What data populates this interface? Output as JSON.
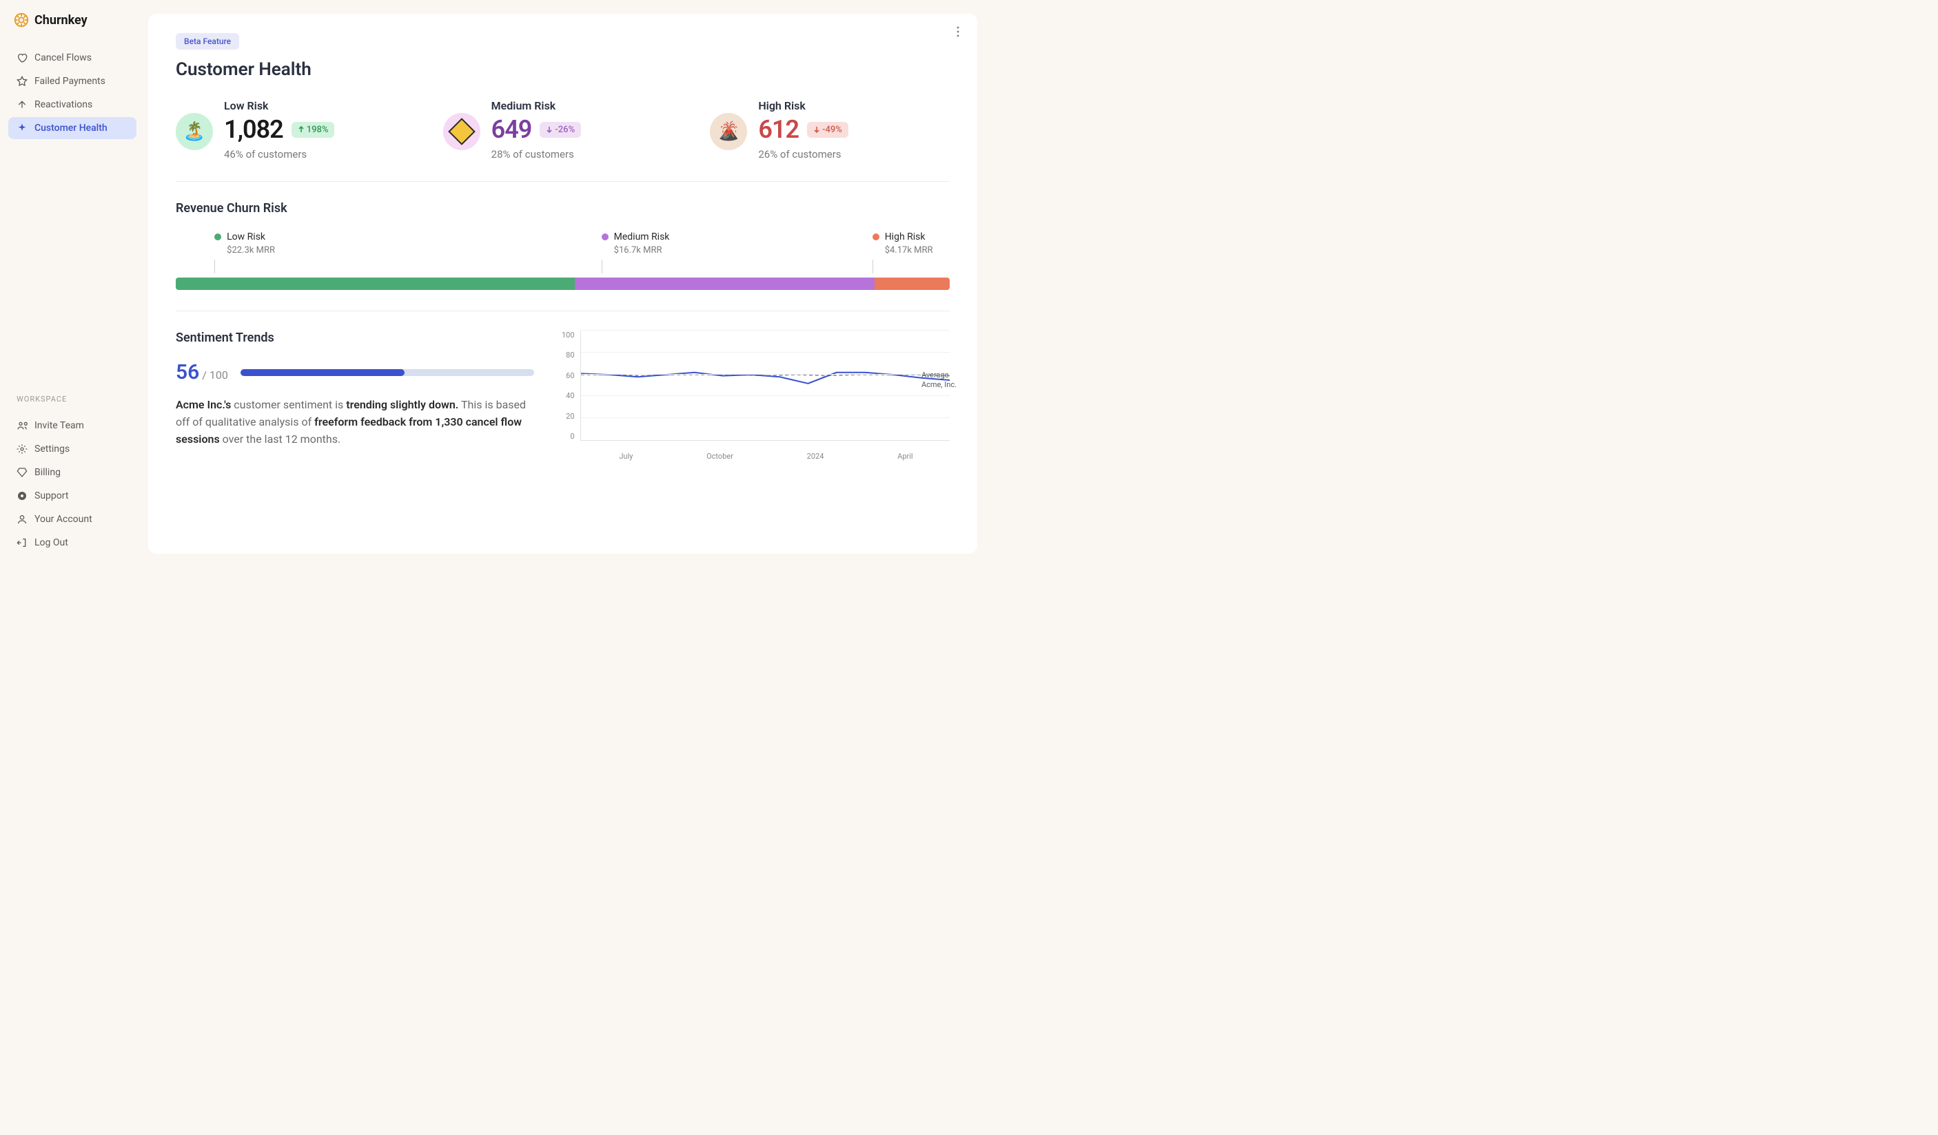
{
  "brand": "Churnkey",
  "sidebar": {
    "items": [
      {
        "label": "Cancel Flows",
        "icon": "heart-icon"
      },
      {
        "label": "Failed Payments",
        "icon": "star-icon"
      },
      {
        "label": "Reactivations",
        "icon": "arrow-up-icon"
      },
      {
        "label": "Customer Health",
        "icon": "sparkle-icon",
        "active": true
      }
    ],
    "workspace_label": "WORKSPACE",
    "workspace_items": [
      {
        "label": "Invite Team",
        "icon": "users-icon"
      },
      {
        "label": "Settings",
        "icon": "gear-icon"
      },
      {
        "label": "Billing",
        "icon": "diamond-icon"
      },
      {
        "label": "Support",
        "icon": "lifebuoy-icon"
      },
      {
        "label": "Your Account",
        "icon": "user-icon"
      },
      {
        "label": "Log Out",
        "icon": "logout-icon"
      }
    ]
  },
  "page": {
    "beta_badge": "Beta Feature",
    "title": "Customer Health"
  },
  "risk": {
    "low": {
      "label": "Low Risk",
      "value": "1,082",
      "delta": "198%",
      "dir": "up",
      "sub": "46% of customers",
      "emoji": "🏝️"
    },
    "med": {
      "label": "Medium Risk",
      "value": "649",
      "delta": "-26%",
      "dir": "down",
      "sub": "28% of customers",
      "emoji": "⚠️"
    },
    "high": {
      "label": "High Risk",
      "value": "612",
      "delta": "-49%",
      "dir": "down",
      "sub": "26% of customers",
      "emoji": "🌋"
    }
  },
  "revenue": {
    "title": "Revenue Churn Risk",
    "low": {
      "label": "Low Risk",
      "value": "$22.3k MRR",
      "pct": 51.6,
      "color": "#4bab74"
    },
    "med": {
      "label": "Medium Risk",
      "value": "$16.7k MRR",
      "pct": 38.7,
      "color": "#b673d9"
    },
    "high": {
      "label": "High Risk",
      "value": "$4.17k MRR",
      "pct": 9.7,
      "color": "#ea7a5a"
    }
  },
  "sentiment": {
    "title": "Sentiment Trends",
    "score": "56",
    "max": "100",
    "company": "Acme Inc.'s",
    "text1": " customer sentiment is ",
    "trend": "trending slightly down.",
    "text2": " This is based off of qualitative analysis of ",
    "sessions": "freeform feedback from 1,330 cancel flow sessions",
    "text3": " over the last 12 months.",
    "legend": {
      "avg": "Average",
      "company": "Acme, Inc."
    }
  },
  "chart_data": {
    "type": "line",
    "ylim": [
      0,
      100
    ],
    "yticks": [
      0,
      20,
      40,
      60,
      80,
      100
    ],
    "xticks": [
      "July",
      "October",
      "2024",
      "April"
    ],
    "series": [
      {
        "name": "Average",
        "values": [
          60,
          60,
          59,
          60,
          60,
          60,
          59,
          60,
          59,
          60,
          60,
          60,
          59
        ]
      },
      {
        "name": "Acme, Inc.",
        "values": [
          61,
          60,
          58,
          60,
          62,
          59,
          60,
          58,
          52,
          62,
          62,
          60,
          57,
          55
        ]
      }
    ]
  }
}
